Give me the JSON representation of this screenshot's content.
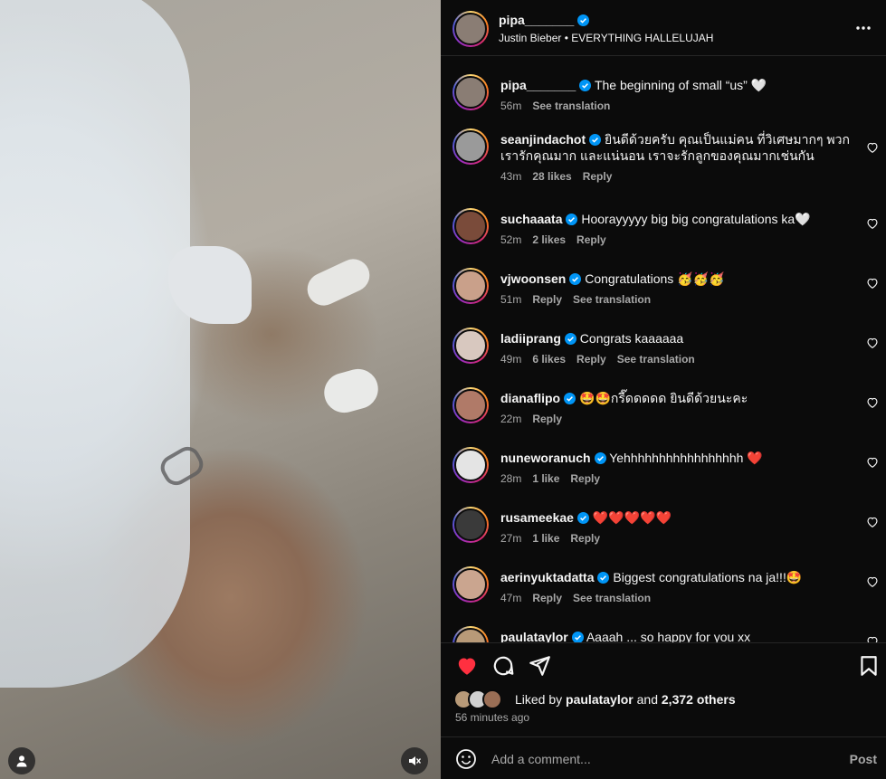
{
  "post": {
    "author": "pipa_______",
    "audio": "Justin Bieber • EVERYTHING HALLELUJAH",
    "caption": "The beginning of small “us” 🤍",
    "caption_time": "56m",
    "see_translation": "See translation"
  },
  "comments": [
    {
      "user": "seanjindachot",
      "text": "ยินดีด้วยครับ คุณเป็นแม่คน ที่วิเศษมากๆ พวกเรารักคุณมาก และแน่นอน เราจะรักลูกของคุณมากเช่นกัน",
      "time": "43m",
      "likes": "28 likes",
      "reply": "Reply",
      "translation": "",
      "avatar": "#9a9a9a"
    },
    {
      "user": "suchaaata",
      "text": "Hoorayyyyy big big congratulations ka🤍",
      "time": "52m",
      "likes": "2 likes",
      "reply": "Reply",
      "translation": "",
      "avatar": "#7a4b3a"
    },
    {
      "user": "vjwoonsen",
      "text": "Congratulations 🥳🥳🥳",
      "time": "51m",
      "likes": "",
      "reply": "Reply",
      "translation": "See translation",
      "avatar": "#c9a08a"
    },
    {
      "user": "ladiiprang",
      "text": "Congrats kaaaaaa",
      "time": "49m",
      "likes": "6 likes",
      "reply": "Reply",
      "translation": "See translation",
      "avatar": "#d8c8bf"
    },
    {
      "user": "dianaflipo",
      "text": "🤩🤩กรี๊ดดดดด ยินดีด้วยนะคะ",
      "time": "22m",
      "likes": "",
      "reply": "Reply",
      "translation": "",
      "avatar": "#b07a68"
    },
    {
      "user": "nuneworanuch",
      "text": "Yehhhhhhhhhhhhhhhhh ❤️",
      "time": "28m",
      "likes": "1 like",
      "reply": "Reply",
      "translation": "",
      "avatar": "#e4e4e4"
    },
    {
      "user": "rusameekae",
      "text": "❤️❤️❤️❤️❤️",
      "time": "27m",
      "likes": "1 like",
      "reply": "Reply",
      "translation": "",
      "avatar": "#3a3a3a"
    },
    {
      "user": "aerinyuktadatta",
      "text": "Biggest congratulations na ja!!!🤩",
      "time": "47m",
      "likes": "",
      "reply": "Reply",
      "translation": "See translation",
      "avatar": "#caa58f"
    },
    {
      "user": "paulataylor",
      "text": "Aaaah ... so happy for you xx",
      "time": "",
      "likes": "",
      "reply": "",
      "translation": "",
      "avatar": "#b89a78"
    }
  ],
  "footer": {
    "liked_by_prefix": "Liked by ",
    "liked_by_user": "paulataylor",
    "liked_by_mid": " and ",
    "liked_by_count": "2,372 others",
    "time_ago": "56 minutes ago",
    "comment_placeholder": "Add a comment...",
    "post_label": "Post"
  },
  "colors": {
    "like_red": "#ff3040",
    "verified_blue": "#0095f6",
    "muted_text": "#a8a8a8"
  },
  "icons": [
    "heart-icon",
    "comment-icon",
    "share-icon",
    "bookmark-icon",
    "more-icon",
    "emoji-icon",
    "user-icon",
    "mute-icon",
    "verified-icon"
  ]
}
